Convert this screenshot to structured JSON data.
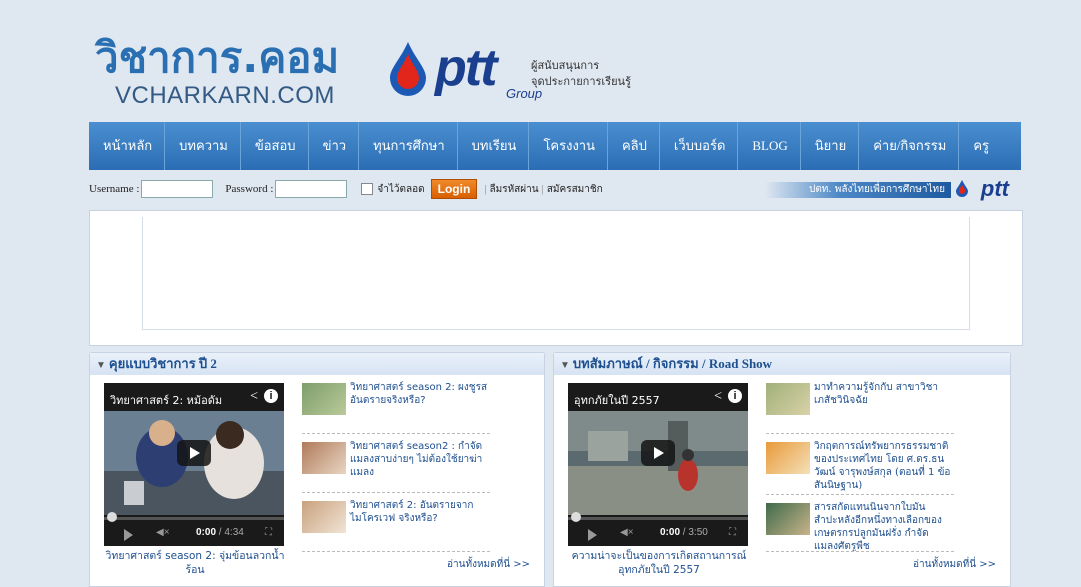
{
  "header": {
    "logo_th": "วิชาการ.คอม",
    "logo_en": "VCHARKARN.COM",
    "ptt_word": "ptt",
    "ptt_group": "Group",
    "tagline_1": "ผู้สนับสนุนการ",
    "tagline_2": "จุดประกายการเรียนรู้"
  },
  "nav": [
    "หน้าหลัก",
    "บทความ",
    "ข้อสอบ",
    "ข่าว",
    "ทุนการศึกษา",
    "บทเรียน",
    "โครงงาน",
    "คลิป",
    "เว็บบอร์ด",
    "BLOG",
    "นิยาย",
    "ค่าย/กิจกรรม",
    "ครู"
  ],
  "login": {
    "username_label": "Username :",
    "password_label": "Password :",
    "remember_label": "จำไว้ตลอด",
    "login_button": "Login",
    "forgot_link": "ลืมรหัสผ่าน",
    "register_link": "สมัครสมาชิก",
    "banner_text": "ปตท. พลังไทยเพื่อการศึกษาไทย",
    "ptt_small": "ptt"
  },
  "panel_left": {
    "title": "คุยแบบวิชาการ ปี 2",
    "video_title": "วิทยาศาสตร์ 2: หม้อดัม",
    "video_time": "0:00",
    "video_duration": "/ 4:34",
    "caption": "วิทยาศาสตร์ season 2: จุ่มข้อนลวกน้ำร้อน",
    "items": [
      "วิทยาศาสตร์ season 2: ผงชูรส อันตรายจริงหรือ?",
      "วิทยาศาสตร์ season2 : กำจัดแมลงสาบง่ายๆ ไม่ต้องใช้ยาฆ่าแมลง",
      "วิทยาศาสตร์ 2: อันตรายจากไมโครเวฟ จริงหรือ?"
    ],
    "more": "อ่านทั้งหมดที่นี่ >>"
  },
  "panel_right": {
    "title": "บทสัมภาษณ์ / กิจกรรม / Road Show",
    "video_title": "อุทกภัยในปี 2557",
    "video_time": "0:00",
    "video_duration": "/ 3:50",
    "caption": "ความน่าจะเป็นของการเกิดสถานการณ์อุทกภัยในปี 2557",
    "items": [
      "มาทำความรู้จักกับ สาขาวิชาเภสัชวินิจฉัย",
      "วิกฤตการณ์ทรัพยากรธรรมชาติของประเทศไทย โดย ศ.ดร.ธนวัฒน์ จารุพงษ์สกุล (ตอนที่ 1 ข้อสันนิษฐาน)",
      "สารสกัดแทนนินจากใบมันสำปะหลังอีกหนึ่งทางเลือกของเกษตรกรปลูกมันฝรั่ง กำจัดแมลงศัตรูพืช"
    ],
    "more": "อ่านทั้งหมดที่นี่ >>"
  },
  "colors": {
    "nav_blue": "#2b6db4",
    "link_blue": "#1e4f8f",
    "login_orange": "#e06a0a",
    "page_bg": "#dfe7f1"
  }
}
